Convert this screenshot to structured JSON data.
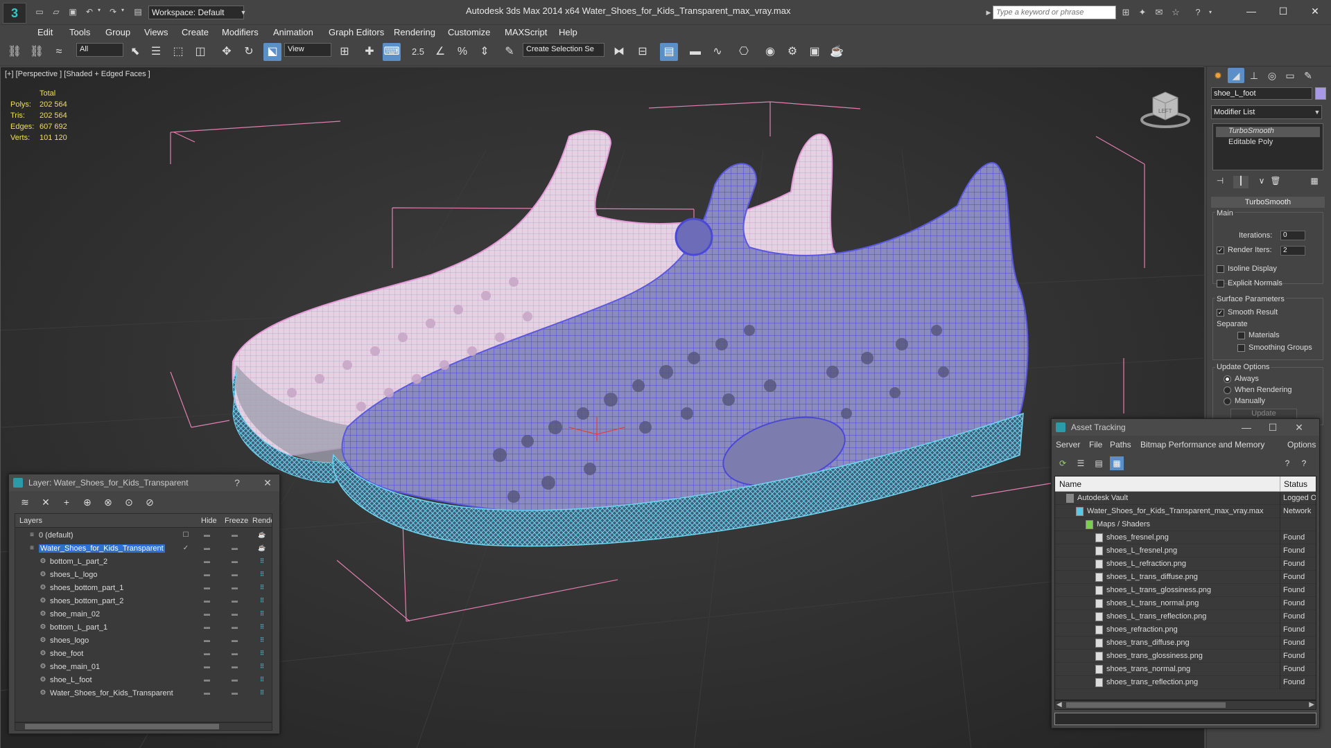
{
  "app": {
    "title": "Autodesk 3ds Max  2014 x64      Water_Shoes_for_Kids_Transparent_max_vray.max",
    "workspace": "Workspace: Default",
    "search_placeholder": "Type a keyword or phrase"
  },
  "menu": [
    "Edit",
    "Tools",
    "Group",
    "Views",
    "Create",
    "Modifiers",
    "Animation",
    "Graph Editors",
    "Rendering",
    "Customize",
    "MAXScript",
    "Help"
  ],
  "toolbar": {
    "selection_filter": "All",
    "reference_coord": "View",
    "named_selection": "Create Selection Se",
    "snap_label": "2.5"
  },
  "viewport": {
    "label": "[+] [Perspective ] [Shaded + Edged Faces ]",
    "stats": {
      "header": "Total",
      "rows": [
        {
          "k": "Polys:",
          "v": "202 564"
        },
        {
          "k": "Tris:",
          "v": "202 564"
        },
        {
          "k": "Edges:",
          "v": "607 692"
        },
        {
          "k": "Verts:",
          "v": "101 120"
        }
      ]
    },
    "viewcube_label": "LEFT"
  },
  "command_panel": {
    "object_name": "shoe_L_foot",
    "object_color": "#a898e8",
    "modifier_list": "Modifier List",
    "stack": [
      "TurboSmooth",
      "Editable Poly"
    ],
    "rollout_title": "TurboSmooth",
    "main_label": "Main",
    "iterations_label": "Iterations:",
    "iterations_value": "0",
    "render_iters_label": "Render Iters:",
    "render_iters_value": "2",
    "isoline": "Isoline Display",
    "explicit_normals": "Explicit Normals",
    "surface_params": "Surface Parameters",
    "smooth_result": "Smooth Result",
    "separate": "Separate",
    "materials": "Materials",
    "smoothing_groups": "Smoothing Groups",
    "update_options": "Update Options",
    "always": "Always",
    "when_rendering": "When Rendering",
    "manually": "Manually",
    "update_btn": "Update"
  },
  "layer_window": {
    "title": "Layer: Water_Shoes_for_Kids_Transparent",
    "help": "?",
    "columns": [
      "Layers",
      "Hide",
      "Freeze",
      "Render"
    ],
    "rows": [
      {
        "name": "0 (default)",
        "indent": 0,
        "selected": false
      },
      {
        "name": "Water_Shoes_for_Kids_Transparent",
        "indent": 0,
        "selected": true
      },
      {
        "name": "bottom_L_part_2",
        "indent": 1,
        "selected": false
      },
      {
        "name": "shoes_L_logo",
        "indent": 1,
        "selected": false
      },
      {
        "name": "shoes_bottom_part_1",
        "indent": 1,
        "selected": false
      },
      {
        "name": "shoes_bottom_part_2",
        "indent": 1,
        "selected": false
      },
      {
        "name": "shoe_main_02",
        "indent": 1,
        "selected": false
      },
      {
        "name": "bottom_L_part_1",
        "indent": 1,
        "selected": false
      },
      {
        "name": "shoes_logo",
        "indent": 1,
        "selected": false
      },
      {
        "name": "shoe_foot",
        "indent": 1,
        "selected": false
      },
      {
        "name": "shoe_main_01",
        "indent": 1,
        "selected": false
      },
      {
        "name": "shoe_L_foot",
        "indent": 1,
        "selected": false
      },
      {
        "name": "Water_Shoes_for_Kids_Transparent",
        "indent": 1,
        "selected": false
      }
    ]
  },
  "asset_window": {
    "title": "Asset Tracking",
    "menu": [
      "Server",
      "File",
      "Paths",
      "Bitmap Performance and Memory",
      "Options"
    ],
    "columns": [
      "Name",
      "Status"
    ],
    "rows": [
      {
        "name": "Autodesk Vault",
        "status": "Logged O",
        "indent": 0
      },
      {
        "name": "Water_Shoes_for_Kids_Transparent_max_vray.max",
        "status": "Network",
        "indent": 1
      },
      {
        "name": "Maps / Shaders",
        "status": "",
        "indent": 2
      },
      {
        "name": "shoes_fresnel.png",
        "status": "Found",
        "indent": 3
      },
      {
        "name": "shoes_L_fresnel.png",
        "status": "Found",
        "indent": 3
      },
      {
        "name": "shoes_L_refraction.png",
        "status": "Found",
        "indent": 3
      },
      {
        "name": "shoes_L_trans_diffuse.png",
        "status": "Found",
        "indent": 3
      },
      {
        "name": "shoes_L_trans_glossiness.png",
        "status": "Found",
        "indent": 3
      },
      {
        "name": "shoes_L_trans_normal.png",
        "status": "Found",
        "indent": 3
      },
      {
        "name": "shoes_L_trans_reflection.png",
        "status": "Found",
        "indent": 3
      },
      {
        "name": "shoes_refraction.png",
        "status": "Found",
        "indent": 3
      },
      {
        "name": "shoes_trans_diffuse.png",
        "status": "Found",
        "indent": 3
      },
      {
        "name": "shoes_trans_glossiness.png",
        "status": "Found",
        "indent": 3
      },
      {
        "name": "shoes_trans_normal.png",
        "status": "Found",
        "indent": 3
      },
      {
        "name": "shoes_trans_reflection.png",
        "status": "Found",
        "indent": 3
      }
    ]
  },
  "colors": {
    "selection_blue": "#2f6fd0",
    "stats_yellow": "#f0e050",
    "bbox_pink": "#e27fb0",
    "wire_blue": "#5a58e0",
    "wire_pink": "#e6a8dc",
    "sole_cyan": "#58c8e8"
  }
}
